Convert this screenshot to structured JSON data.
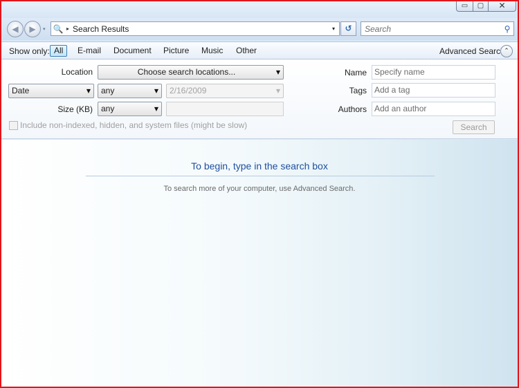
{
  "window": {
    "minimize_glyph": "▭",
    "maximize_glyph": "▢",
    "close_glyph": "✕"
  },
  "nav": {
    "back_glyph": "◀",
    "forward_glyph": "▶",
    "recent_glyph": "▾",
    "address_icon": "🔍",
    "breadcrumb_sep": "▸",
    "address_text": "Search Results",
    "address_drop": "▾",
    "refresh_glyph": "↺"
  },
  "search": {
    "placeholder": "Search",
    "icon": "search-icon"
  },
  "filters": {
    "show_only_label": "Show only:",
    "tabs": [
      "All",
      "E-mail",
      "Document",
      "Picture",
      "Music",
      "Other"
    ],
    "active_tab": "All",
    "advanced_label": "Advanced Search",
    "advanced_toggle_glyph": "⌃"
  },
  "advanced": {
    "location_label": "Location",
    "location_value": "Choose search locations...",
    "date_field_value": "Date",
    "date_operator_value": "any",
    "date_value": "2/16/2009",
    "size_label": "Size (KB)",
    "size_operator_value": "any",
    "size_value": "",
    "include_nonindexed_label": "Include non-indexed, hidden, and system files (might be slow)",
    "name_label": "Name",
    "name_placeholder": "Specify name",
    "tags_label": "Tags",
    "tags_placeholder": "Add a tag",
    "authors_label": "Authors",
    "authors_placeholder": "Add an author",
    "search_button_label": "Search",
    "dropdown_arrow": "▼"
  },
  "content": {
    "title": "To begin, type in the search box",
    "subtitle": "To search more of your computer, use Advanced Search."
  }
}
